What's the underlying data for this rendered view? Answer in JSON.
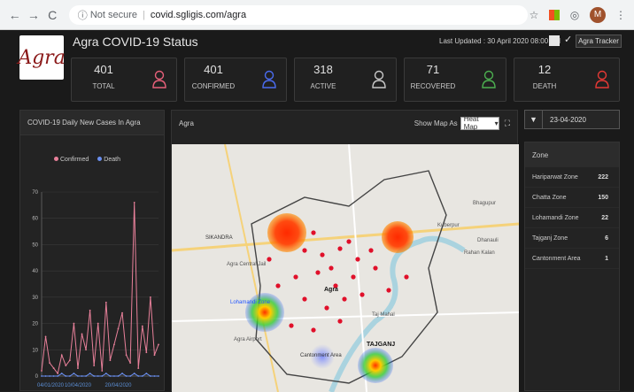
{
  "browser": {
    "security": "Not secure",
    "url": "covid.sgligis.com/agra",
    "avatar_letter": "M"
  },
  "header": {
    "title": "Agra COVID-19 Status",
    "last_updated": "Last Updated : 30 April 2020 08:00 AM",
    "tracker_button": "Agra Tracker",
    "logo_text": "Agra"
  },
  "stats": [
    {
      "value": "401",
      "label": "TOTAL",
      "color": "#e8607a"
    },
    {
      "value": "401",
      "label": "CONFIRMED",
      "color": "#4a6cf0"
    },
    {
      "value": "318",
      "label": "ACTIVE",
      "color": "#c8c8c8"
    },
    {
      "value": "71",
      "label": "RECOVERED",
      "color": "#4caf50"
    },
    {
      "value": "12",
      "label": "DEATH",
      "color": "#e53935"
    }
  ],
  "chart_panel": {
    "title": "COVID-19 Daily New Cases In Agra"
  },
  "chart_data": {
    "type": "line",
    "title": "COVID-19 Daily New Cases In Agra",
    "xlabel": "",
    "ylabel": "",
    "ylim": [
      0,
      70
    ],
    "yticks": [
      0,
      10,
      20,
      30,
      40,
      50,
      60,
      70
    ],
    "xticks": [
      "04/01/2020",
      "10/04/2020",
      "20/04/2020"
    ],
    "x": [
      "04/01",
      "04/02",
      "04/03",
      "04/04",
      "04/05",
      "04/06",
      "04/07",
      "04/08",
      "04/09",
      "04/10",
      "04/11",
      "04/12",
      "04/13",
      "04/14",
      "04/15",
      "04/16",
      "04/17",
      "04/18",
      "04/19",
      "04/20",
      "04/21",
      "04/22",
      "04/23",
      "04/24",
      "04/25",
      "04/26",
      "04/27",
      "04/28",
      "04/29",
      "04/30"
    ],
    "series": [
      {
        "name": "Confirmed",
        "color": "#e8809a",
        "values": [
          2,
          15,
          5,
          3,
          1,
          8,
          4,
          6,
          20,
          3,
          16,
          10,
          25,
          4,
          20,
          2,
          28,
          6,
          12,
          18,
          24,
          8,
          5,
          66,
          3,
          19,
          9,
          30,
          8,
          12
        ]
      },
      {
        "name": "Death",
        "color": "#6a8ff0",
        "values": [
          0,
          0,
          0,
          0,
          0,
          1,
          0,
          0,
          1,
          0,
          0,
          0,
          1,
          0,
          0,
          0,
          1,
          0,
          0,
          0,
          1,
          0,
          0,
          1,
          0,
          0,
          1,
          0,
          0,
          0
        ]
      }
    ],
    "grid": true,
    "legend": "top"
  },
  "map_panel": {
    "title": "Agra",
    "show_map_as": "Show Map As",
    "map_mode": "Heat Map"
  },
  "map_labels": [
    "SIKANDRA",
    "Agra Central Jail",
    "Agra",
    "Kuberpur",
    "Dhanauli",
    "Rahan Kalan",
    "Lohamandi Zone",
    "TAJGANJ",
    "Cantonment Area",
    "Taj Mahal",
    "Bhagupur",
    "Agra Airport"
  ],
  "date_filter": {
    "value": "23-04-2020"
  },
  "zones": {
    "header": "Zone",
    "rows": [
      {
        "name": "Hariparwat Zone",
        "value": "222"
      },
      {
        "name": "Chatta Zone",
        "value": "150"
      },
      {
        "name": "Lohamandi Zone",
        "value": "22"
      },
      {
        "name": "Tajganj Zone",
        "value": "6"
      },
      {
        "name": "Cantonment Area",
        "value": "1"
      }
    ]
  }
}
